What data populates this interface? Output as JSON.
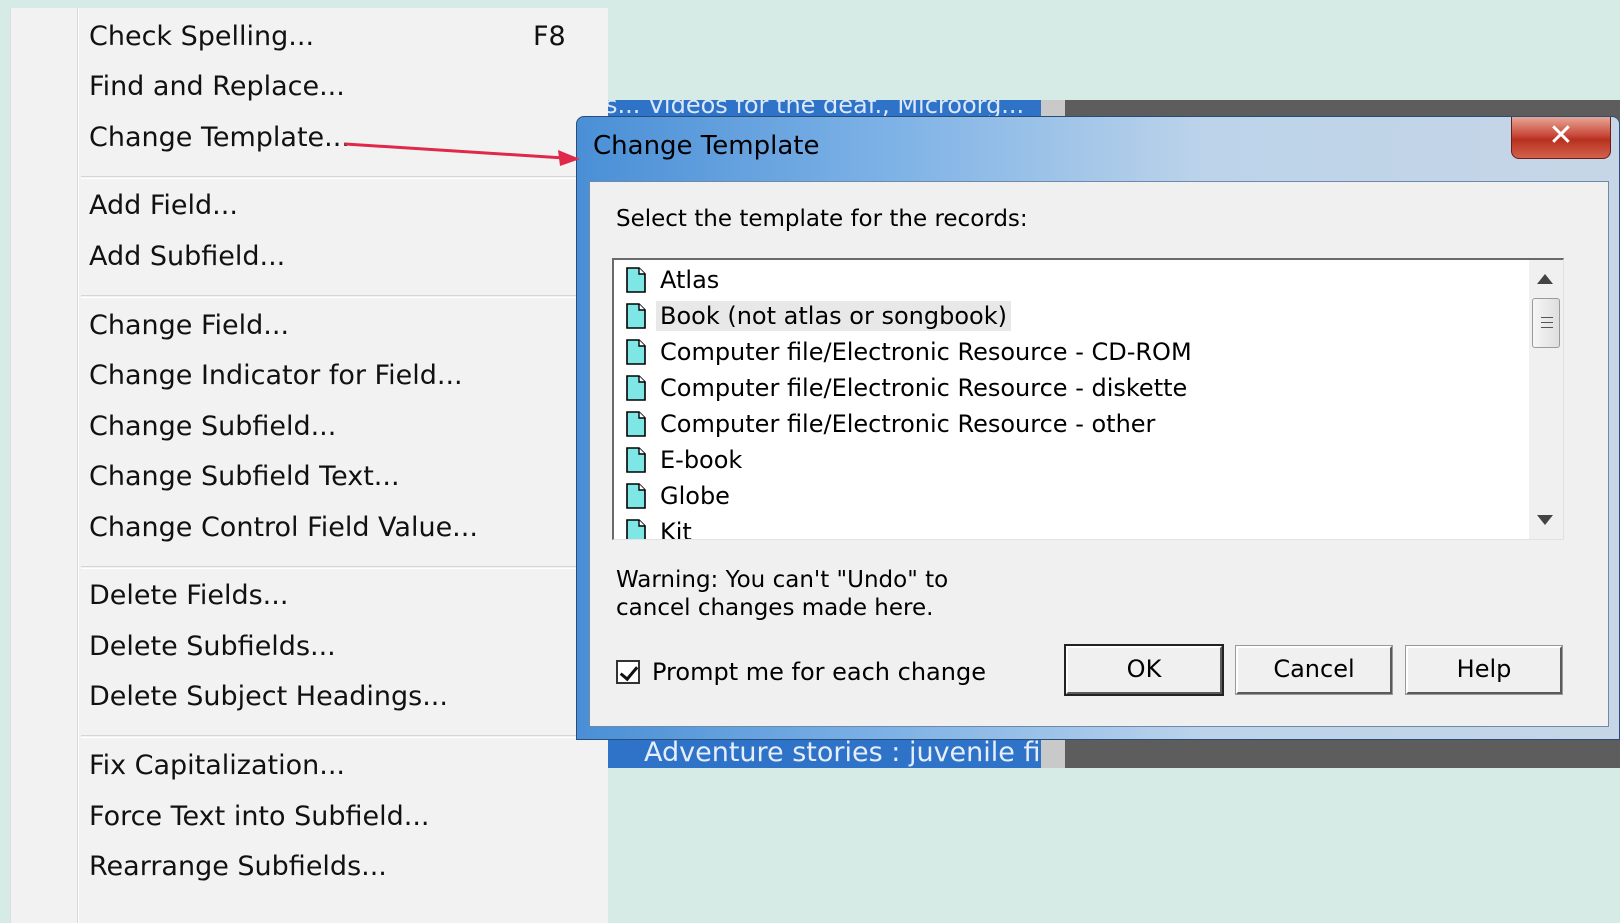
{
  "menu": {
    "items": [
      {
        "label": "Check Spelling...",
        "shortcut": "F8"
      },
      {
        "label": "Find and Replace..."
      },
      {
        "label": "Change Template..."
      },
      {
        "label": "Add Field..."
      },
      {
        "label": "Add Subfield..."
      },
      {
        "label": "Change Field..."
      },
      {
        "label": "Change Indicator for Field..."
      },
      {
        "label": "Change Subfield..."
      },
      {
        "label": "Change Subfield Text..."
      },
      {
        "label": "Change Control Field Value..."
      },
      {
        "label": "Delete Fields..."
      },
      {
        "label": "Delete Subfields..."
      },
      {
        "label": "Delete Subject Headings..."
      },
      {
        "label": "Fix Capitalization..."
      },
      {
        "label": "Force Text into Subfield..."
      },
      {
        "label": "Rearrange Subfields..."
      }
    ]
  },
  "background": {
    "top_text": "sss... Videos for the deaf., Microorg...",
    "bottom_text": "Adventure stories : juvenile fic"
  },
  "dialog": {
    "title": "Change Template",
    "close_label": "✕",
    "prompt": "Select the template for the records:",
    "templates": [
      "Atlas",
      "Book (not atlas or songbook)",
      "Computer file/Electronic Resource - CD-ROM",
      "Computer file/Electronic Resource - diskette",
      "Computer file/Electronic Resource - other",
      "E-book",
      "Globe",
      "Kit"
    ],
    "selected_template": "Book (not atlas or songbook)",
    "warning_line1": "Warning: You can't \"Undo\" to",
    "warning_line2": "cancel changes made here.",
    "checkbox_label": "Prompt me for each change",
    "checkbox_checked": true,
    "buttons": {
      "ok": "OK",
      "cancel": "Cancel",
      "help": "Help"
    }
  },
  "colors": {
    "page_bg": "#d6ebe5",
    "arrow": "#e0284a",
    "doc_icon_fill": "#7fe6e6"
  }
}
